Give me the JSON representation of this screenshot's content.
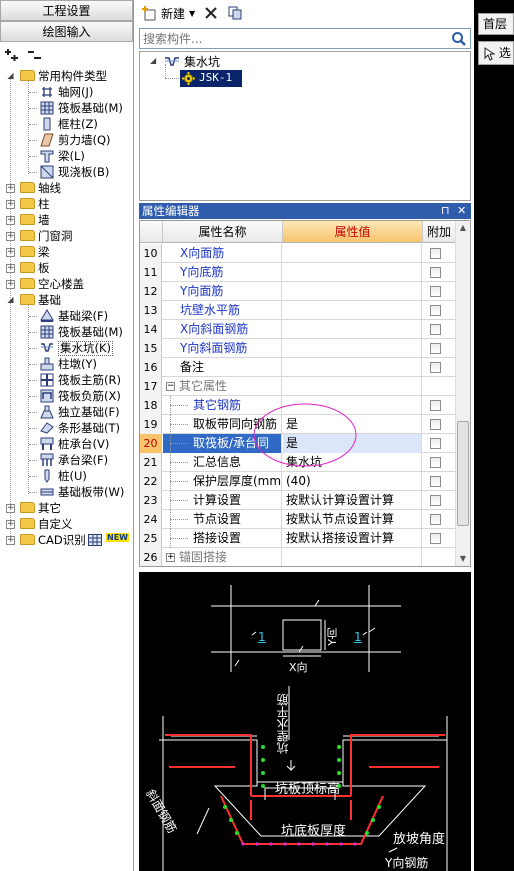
{
  "left_panel": {
    "btn_project_settings": "工程设置",
    "btn_drawing_input": "绘图输入",
    "tree": {
      "common_types": "常用构件类型",
      "common_items": [
        "轴网(J)",
        "筏板基础(M)",
        "框柱(Z)",
        "剪力墙(Q)",
        "梁(L)",
        "现浇板(B)"
      ],
      "axis": "轴线",
      "column": "柱",
      "wall": "墙",
      "door_window": "门窗洞",
      "beam": "梁",
      "slab": "板",
      "hollow_slab": "空心楼盖",
      "foundation": "基础",
      "foundation_items": [
        "基础梁(F)",
        "筏板基础(M)",
        "集水坑(K)",
        "柱墩(Y)",
        "筏板主筋(R)",
        "筏板负筋(X)",
        "独立基础(F)",
        "条形基础(T)",
        "桩承台(V)",
        "承台梁(F)",
        "桩(U)",
        "基础板带(W)"
      ],
      "other": "其它",
      "custom": "自定义",
      "cad": "CAD识别",
      "new_badge": "NEW"
    }
  },
  "mid_panel": {
    "toolbar": {
      "new_label": "新建"
    },
    "search": {
      "placeholder": "搜索构件..."
    },
    "component_tree": {
      "root": "集水坑",
      "child": "JSK-1"
    },
    "prop_editor": {
      "title": "属性编辑器",
      "pin": "ㅁ",
      "close": "✕",
      "columns": [
        "属性名称",
        "属性值",
        "附加"
      ],
      "rows": [
        {
          "num": "10",
          "name": "X向面筋",
          "value": "",
          "blue": true,
          "indent": 1
        },
        {
          "num": "11",
          "name": "Y向底筋",
          "value": "",
          "blue": true,
          "indent": 1
        },
        {
          "num": "12",
          "name": "Y向面筋",
          "value": "",
          "blue": true,
          "indent": 1
        },
        {
          "num": "13",
          "name": "坑壁水平筋",
          "value": "",
          "blue": true,
          "indent": 1
        },
        {
          "num": "14",
          "name": "X向斜面钢筋",
          "value": "",
          "blue": true,
          "indent": 1
        },
        {
          "num": "15",
          "name": "Y向斜面钢筋",
          "value": "",
          "blue": true,
          "indent": 1
        },
        {
          "num": "16",
          "name": "备注",
          "value": "",
          "blue": false,
          "indent": 1
        },
        {
          "num": "17",
          "name": "其它属性",
          "value": "",
          "blue": false,
          "group": true
        },
        {
          "num": "18",
          "name": "其它钢筋",
          "value": "",
          "blue": true,
          "indent": 2
        },
        {
          "num": "19",
          "name": "取板带同向钢筋",
          "value": "是",
          "blue": false,
          "indent": 2
        },
        {
          "num": "20",
          "name": "取筏板/承台同",
          "value": "是",
          "blue": false,
          "indent": 2,
          "selected": true
        },
        {
          "num": "21",
          "name": "汇总信息",
          "value": "集水坑",
          "blue": false,
          "indent": 2
        },
        {
          "num": "22",
          "name": "保护层厚度(mm)",
          "value": "(40)",
          "blue": false,
          "indent": 2
        },
        {
          "num": "23",
          "name": "计算设置",
          "value": "按默认计算设置计算",
          "blue": false,
          "indent": 2
        },
        {
          "num": "24",
          "name": "节点设置",
          "value": "按默认节点设置计算",
          "blue": false,
          "indent": 2
        },
        {
          "num": "25",
          "name": "搭接设置",
          "value": "按默认搭接设置计算",
          "blue": false,
          "indent": 2
        },
        {
          "num": "26",
          "name": "锚固搭接",
          "value": "",
          "blue": false,
          "group": true,
          "collapsed": true
        }
      ]
    },
    "drawing": {
      "lbl_1a": "1",
      "lbl_1b": "1",
      "y_dir": "Y向",
      "x_dir": "X向",
      "wall_horiz": "坑壁水平筋",
      "pit_top": "坑板顶标高",
      "pit_thick": "坑底板厚度",
      "slope": "放坡角度",
      "slant": "斜面钢筋",
      "y_rebar": "Y向钢筋"
    }
  },
  "right_panel": {
    "tab_label": "首层",
    "tool_label": "选"
  }
}
